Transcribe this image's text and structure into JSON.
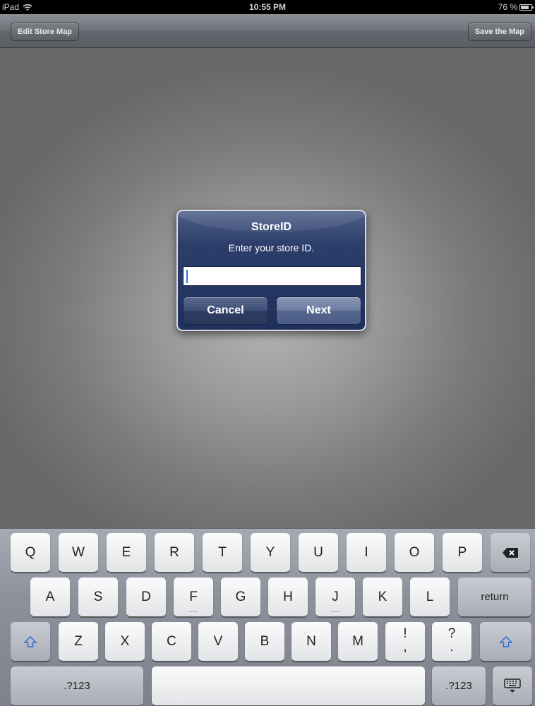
{
  "status_bar": {
    "device": "iPad",
    "time": "10:55 PM",
    "battery": "76 %",
    "battery_level": 0.76
  },
  "navbar": {
    "left_button": "Edit Store Map",
    "right_button": "Save the Map"
  },
  "alert": {
    "title": "StoreID",
    "message": "Enter your store ID.",
    "input_value": "",
    "cancel_label": "Cancel",
    "next_label": "Next"
  },
  "keyboard": {
    "row1": [
      "Q",
      "W",
      "E",
      "R",
      "T",
      "Y",
      "U",
      "I",
      "O",
      "P"
    ],
    "row2": [
      "A",
      "S",
      "D",
      "F",
      "G",
      "H",
      "J",
      "K",
      "L"
    ],
    "row3": [
      "Z",
      "X",
      "C",
      "V",
      "B",
      "N",
      "M"
    ],
    "return_label": "return",
    "excl_top": "!",
    "excl_bottom": ",",
    "quest_top": "?",
    "quest_bottom": ".",
    "numbers_label_left": ".?123",
    "numbers_label_right": ".?123",
    "icons": [
      "backspace-icon",
      "shift-icon",
      "keyboard-dismiss-icon"
    ]
  }
}
